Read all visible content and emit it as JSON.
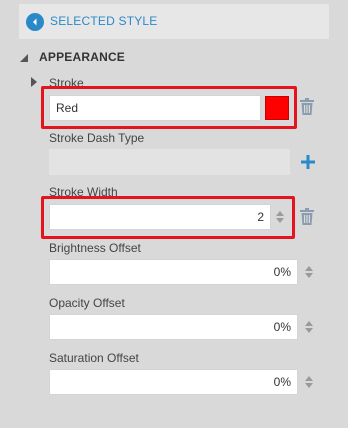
{
  "header": {
    "title": "SELECTED STYLE"
  },
  "section": {
    "title": "APPEARANCE"
  },
  "stroke": {
    "label": "Stroke",
    "value": "Red",
    "swatch_color": "#ff0000"
  },
  "stroke_dash_type": {
    "label": "Stroke Dash Type"
  },
  "stroke_width": {
    "label": "Stroke Width",
    "value": "2"
  },
  "brightness_offset": {
    "label": "Brightness Offset",
    "value": "0%"
  },
  "opacity_offset": {
    "label": "Opacity Offset",
    "value": "0%"
  },
  "saturation_offset": {
    "label": "Saturation Offset",
    "value": "0%"
  },
  "colors": {
    "accent": "#2a8ac9",
    "highlight": "#e3141e"
  },
  "icons": [
    "back-arrow-icon",
    "caret-down-icon",
    "caret-right-icon",
    "trash-icon",
    "plus-icon",
    "spinner-icon"
  ]
}
